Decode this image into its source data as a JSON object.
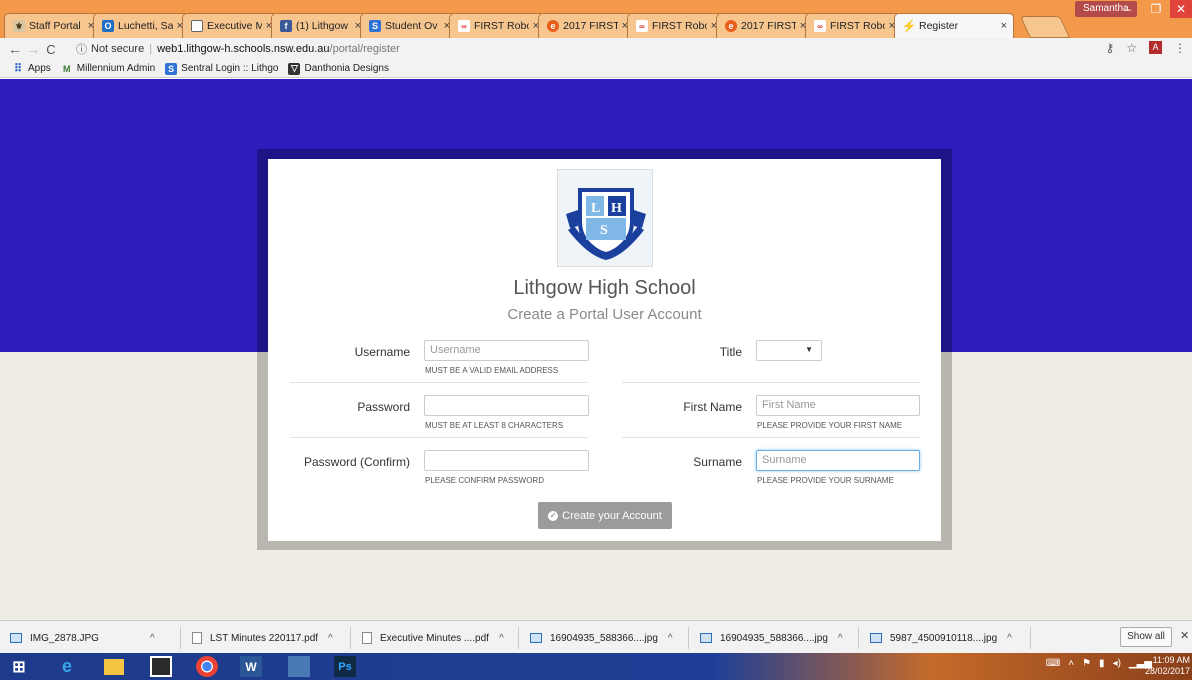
{
  "browser": {
    "tabs": [
      {
        "label": "Staff Portal",
        "icon": "school-crest-icon"
      },
      {
        "label": "Luchetti, Sa",
        "icon": "outlook-icon"
      },
      {
        "label": "Executive M",
        "icon": "document-icon"
      },
      {
        "label": "(1) Lithgow",
        "icon": "facebook-icon"
      },
      {
        "label": "Student Ov",
        "icon": "sentral-icon"
      },
      {
        "label": "FIRST Robo",
        "icon": "first-robotics-icon"
      },
      {
        "label": "2017 FIRST",
        "icon": "orange-circle-icon"
      },
      {
        "label": "FIRST Robo",
        "icon": "first-robotics-icon"
      },
      {
        "label": "2017 FIRST",
        "icon": "orange-circle-icon"
      },
      {
        "label": "FIRST Robo",
        "icon": "first-robotics-icon"
      },
      {
        "label": "Register",
        "icon": "sentral-bolt-icon",
        "active": true
      }
    ],
    "profile_name": "Samantha",
    "address": {
      "security": "Not secure",
      "host": "web1.lithgow-h.schools.nsw.edu.au",
      "path": "/portal/register"
    },
    "bookmarks": [
      {
        "label": "Apps",
        "icon": "apps-grid-icon"
      },
      {
        "label": "Millennium Admin",
        "icon": "millennium-icon"
      },
      {
        "label": "Sentral Login :: Lithgo",
        "icon": "sentral-icon"
      },
      {
        "label": "Danthonia Designs",
        "icon": "danthonia-icon"
      }
    ]
  },
  "form": {
    "school_name": "Lithgow High School",
    "subtitle": "Create a Portal User Account",
    "username": {
      "label": "Username",
      "placeholder": "Username",
      "hint": "MUST BE A VALID EMAIL ADDRESS"
    },
    "password": {
      "label": "Password",
      "placeholder": "",
      "hint": "MUST BE AT LEAST 8 CHARACTERS"
    },
    "password_confirm": {
      "label": "Password (Confirm)",
      "placeholder": "",
      "hint": "PLEASE CONFIRM PASSWORD"
    },
    "title": {
      "label": "Title",
      "selected": ""
    },
    "first_name": {
      "label": "First Name",
      "placeholder": "First Name",
      "hint": "PLEASE PROVIDE YOUR FIRST NAME"
    },
    "surname": {
      "label": "Surname",
      "placeholder": "Surname",
      "hint": "PLEASE PROVIDE YOUR SURNAME"
    },
    "submit_label": "Create your Account"
  },
  "downloads": {
    "items": [
      {
        "name": "IMG_2878.JPG",
        "type": "image"
      },
      {
        "name": "LST Minutes 220117.pdf",
        "type": "pdf"
      },
      {
        "name": "Executive Minutes ....pdf",
        "type": "pdf"
      },
      {
        "name": "16904935_588366....jpg",
        "type": "image"
      },
      {
        "name": "16904935_588366....jpg",
        "type": "image"
      },
      {
        "name": "5987_4500910118....jpg",
        "type": "image"
      }
    ],
    "show_all": "Show all"
  },
  "taskbar": {
    "time": "11:09 AM",
    "date": "28/02/2017"
  },
  "colors": {
    "hero": "#2e1cbd",
    "frame_top": "#1d1587",
    "frame_bottom": "#b8b6ae",
    "page_bg": "#f0ede6",
    "button": "#9b9b9b",
    "tab_bar": "#f29a4a"
  }
}
